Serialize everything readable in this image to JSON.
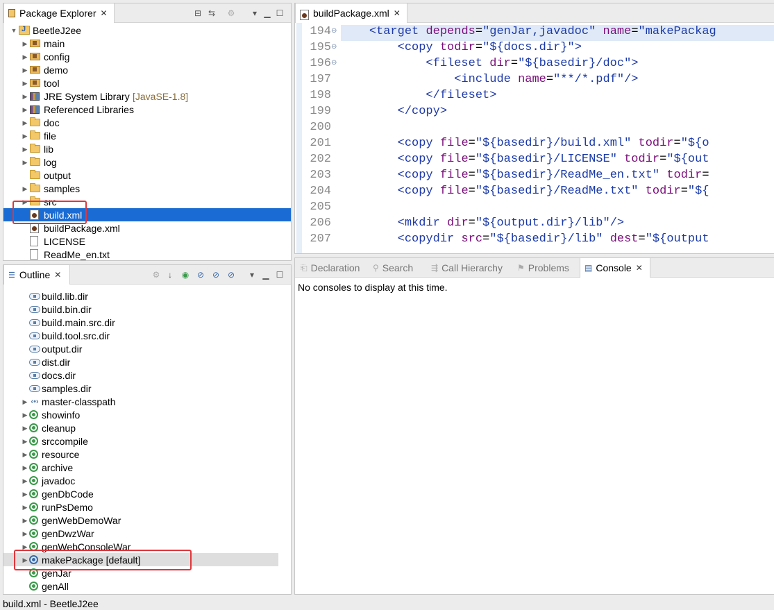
{
  "package_explorer": {
    "title": "Package Explorer",
    "items": [
      {
        "label": "BeetleJ2ee",
        "icon": "project-icon"
      },
      {
        "label": "main",
        "icon": "source-folder-icon"
      },
      {
        "label": "config",
        "icon": "source-folder-icon"
      },
      {
        "label": "demo",
        "icon": "source-folder-icon"
      },
      {
        "label": "tool",
        "icon": "source-folder-icon"
      },
      {
        "label": "JRE System Library",
        "decoration": "[JavaSE-1.8]",
        "icon": "library-icon"
      },
      {
        "label": "Referenced Libraries",
        "icon": "library-icon"
      },
      {
        "label": "doc",
        "icon": "folder-icon"
      },
      {
        "label": "file",
        "icon": "folder-icon"
      },
      {
        "label": "lib",
        "icon": "folder-icon"
      },
      {
        "label": "log",
        "icon": "folder-icon"
      },
      {
        "label": "output",
        "icon": "folder-icon"
      },
      {
        "label": "samples",
        "icon": "folder-icon"
      },
      {
        "label": "src",
        "icon": "folder-icon"
      },
      {
        "label": "build.xml",
        "icon": "ant-file-icon"
      },
      {
        "label": "buildPackage.xml",
        "icon": "ant-file-icon"
      },
      {
        "label": "LICENSE",
        "icon": "file-icon"
      },
      {
        "label": "ReadMe_en.txt",
        "icon": "file-icon"
      }
    ]
  },
  "outline": {
    "title": "Outline",
    "items": [
      {
        "label": "build.lib.dir",
        "icon": "property-icon"
      },
      {
        "label": "build.bin.dir",
        "icon": "property-icon"
      },
      {
        "label": "build.main.src.dir",
        "icon": "property-icon"
      },
      {
        "label": "build.tool.src.dir",
        "icon": "property-icon"
      },
      {
        "label": "output.dir",
        "icon": "property-icon"
      },
      {
        "label": "dist.dir",
        "icon": "property-icon"
      },
      {
        "label": "docs.dir",
        "icon": "property-icon"
      },
      {
        "label": "samples.dir",
        "icon": "property-icon"
      },
      {
        "label": "master-classpath",
        "icon": "path-icon"
      },
      {
        "label": "showinfo",
        "icon": "target-icon"
      },
      {
        "label": "cleanup",
        "icon": "target-icon"
      },
      {
        "label": "srccompile",
        "icon": "target-icon"
      },
      {
        "label": "resource",
        "icon": "target-icon"
      },
      {
        "label": "archive",
        "icon": "target-icon"
      },
      {
        "label": "javadoc",
        "icon": "target-icon"
      },
      {
        "label": "genDbCode",
        "icon": "target-icon"
      },
      {
        "label": "runPsDemo",
        "icon": "target-icon"
      },
      {
        "label": "genWebDemoWar",
        "icon": "target-icon"
      },
      {
        "label": "genDwzWar",
        "icon": "target-icon"
      },
      {
        "label": "genWebConsoleWar",
        "icon": "target-icon"
      },
      {
        "label": "makePackage [default]",
        "icon": "default-target-icon"
      },
      {
        "label": "genJar",
        "icon": "target-icon"
      },
      {
        "label": "genAll",
        "icon": "target-icon"
      }
    ]
  },
  "editor": {
    "tab_title": "buildPackage.xml",
    "lines": [
      {
        "n": "194",
        "fold": "⊖",
        "text": "    <target depends=\"genJar,javadoc\" name=\"makePackag"
      },
      {
        "n": "195",
        "fold": "⊖",
        "text": "        <copy todir=\"${docs.dir}\">"
      },
      {
        "n": "196",
        "fold": "⊖",
        "text": "            <fileset dir=\"${basedir}/doc\">"
      },
      {
        "n": "197",
        "fold": "",
        "text": "                <include name=\"**/*.pdf\"/>"
      },
      {
        "n": "198",
        "fold": "",
        "text": "            </fileset>"
      },
      {
        "n": "199",
        "fold": "",
        "text": "        </copy>"
      },
      {
        "n": "200",
        "fold": "",
        "text": ""
      },
      {
        "n": "201",
        "fold": "",
        "text": "        <copy file=\"${basedir}/build.xml\" todir=\"${o"
      },
      {
        "n": "202",
        "fold": "",
        "text": "        <copy file=\"${basedir}/LICENSE\" todir=\"${out"
      },
      {
        "n": "203",
        "fold": "",
        "text": "        <copy file=\"${basedir}/ReadMe_en.txt\" todir="
      },
      {
        "n": "204",
        "fold": "",
        "text": "        <copy file=\"${basedir}/ReadMe.txt\" todir=\"${"
      },
      {
        "n": "205",
        "fold": "",
        "text": ""
      },
      {
        "n": "206",
        "fold": "",
        "text": "        <mkdir dir=\"${output.dir}/lib\"/>"
      },
      {
        "n": "207",
        "fold": "",
        "text": "        <copydir src=\"${basedir}/lib\" dest=\"${output"
      }
    ]
  },
  "bottom_tabs": [
    {
      "label": "Declaration",
      "icon": "declaration-icon"
    },
    {
      "label": "Search",
      "icon": "search-icon"
    },
    {
      "label": "Call Hierarchy",
      "icon": "call-hierarchy-icon"
    },
    {
      "label": "Problems",
      "icon": "problems-icon"
    },
    {
      "label": "Console",
      "icon": "console-icon",
      "active": true
    }
  ],
  "console": {
    "message": "No consoles to display at this time."
  },
  "status_bar": {
    "text": "build.xml - BeetleJ2ee"
  }
}
